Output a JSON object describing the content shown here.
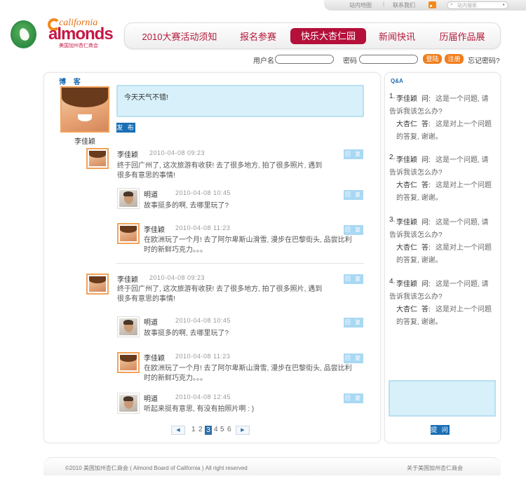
{
  "utility": {
    "sitemap": "站内地图",
    "contact": "联系我们",
    "search_placeholder": "站内搜索"
  },
  "logo": {
    "california": "california",
    "almonds": "almonds",
    "subtitle": "美国加州杏仁商会"
  },
  "nav": {
    "items": [
      {
        "label": "2010大赛活动须知"
      },
      {
        "label": "报名参赛"
      },
      {
        "label": "快乐大杏仁园"
      },
      {
        "label": "新闻快讯"
      },
      {
        "label": "历届作品展"
      }
    ],
    "active_index": 2
  },
  "login": {
    "username_label": "用户名",
    "password_label": "密码",
    "login_button": "登陆",
    "register_button": "注册",
    "forgot": "忘记密码?"
  },
  "blog": {
    "title": "博 客",
    "user_name": "李佳颖",
    "post_text": "今天天气不错!",
    "publish_button": "发 布",
    "reply_label": "回 复",
    "threads": [
      {
        "author": "李佳颖",
        "time": "2010-04-08   09:23",
        "body_line1": "终于回广州了, 这次旅游有收获! 去了很多地方, 拍了很多照片, 遇到",
        "body_line2": "很多有意思的事情!",
        "replies": [
          {
            "author": "明道",
            "time": "2010-04-08   10:45",
            "body_line1": "故事挺多的啊, 去哪里玩了?",
            "body_line2": ""
          },
          {
            "author": "李佳颖",
            "time": "2010-04-08   11:23",
            "body_line1": "在欧洲玩了一个月! 去了阿尔卑斯山滑雪, 漫步在巴黎街头, 品尝比利",
            "body_line2": "时的新鲜巧克力。。。"
          }
        ]
      },
      {
        "author": "李佳颖",
        "time": "2010-04-08   09:23",
        "body_line1": "终于回广州了, 这次旅游有收获! 去了很多地方, 拍了很多照片, 遇到",
        "body_line2": "很多有意思的事情!",
        "replies": [
          {
            "author": "明道",
            "time": "2010-04-08   10:45",
            "body_line1": "故事挺多的啊, 去哪里玩了?",
            "body_line2": ""
          },
          {
            "author": "李佳颖",
            "time": "2010-04-08   11:23",
            "body_line1": "在欧洲玩了一个月! 去了阿尔卑斯山滑雪, 漫步在巴黎街头, 品尝比利",
            "body_line2": "时的新鲜巧克力。。。"
          },
          {
            "author": "明道",
            "time": "2010-04-08   12:45",
            "body_line1": "听起来挺有意思, 有没有拍照片啊 : )",
            "body_line2": ""
          }
        ]
      }
    ],
    "pagination": {
      "prev": "◀",
      "next": "▶",
      "pages": [
        "1",
        "2",
        "3",
        "4",
        "5",
        "6"
      ],
      "current": "3"
    }
  },
  "qa": {
    "title": "Q&A",
    "items": [
      {
        "num": "1.",
        "asker": "李佳颖",
        "q_tag": "问:",
        "q_line1": "这是一个问题, 请",
        "q_line2": "告诉我该怎么办?",
        "answerer": "大杏仁",
        "a_tag": "答:",
        "a_line1": "这是对上一个问题",
        "a_line2": "的答复, 谢谢。"
      },
      {
        "num": "2.",
        "asker": "李佳颖",
        "q_tag": "问:",
        "q_line1": "这是一个问题, 请",
        "q_line2": "告诉我该怎么办?",
        "answerer": "大杏仁",
        "a_tag": "答:",
        "a_line1": "这是对上一个问题",
        "a_line2": "的答复, 谢谢。"
      },
      {
        "num": "3.",
        "asker": "李佳颖",
        "q_tag": "问:",
        "q_line1": "这是一个问题, 请",
        "q_line2": "告诉我该怎么办?",
        "answerer": "大杏仁",
        "a_tag": "答:",
        "a_line1": "这是对上一个问题",
        "a_line2": "的答复, 谢谢。"
      },
      {
        "num": "4.",
        "asker": "李佳颖",
        "q_tag": "问:",
        "q_line1": "这是一个问题, 请",
        "q_line2": "告诉我该怎么办?",
        "answerer": "大杏仁",
        "a_tag": "答:",
        "a_line1": "这是对上一个问题",
        "a_line2": "的答复, 谢谢。"
      }
    ],
    "ask_button": "提 问"
  },
  "footer": {
    "copyright": "©2010  美国加州杏仁商会 ( Almond Board of California )  All right reserved",
    "about": "关于美国加州杏仁商会"
  },
  "colors": {
    "brand_red": "#b5103a",
    "accent_orange": "#f07e1d",
    "link_blue": "#1e6cb0",
    "input_blue": "#d7f0fa"
  }
}
